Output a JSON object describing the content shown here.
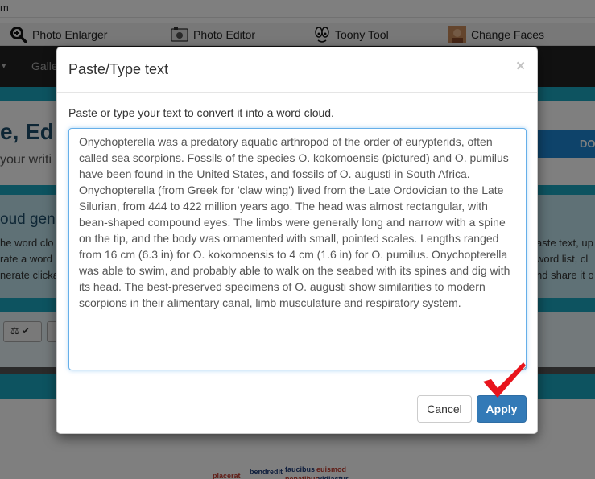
{
  "browser": {
    "url_fragment": "m"
  },
  "toolbar": {
    "items": [
      {
        "label": "Photo Enlarger",
        "icon": "magnifier-icon"
      },
      {
        "label": "Photo Editor",
        "icon": "photo-editor-icon"
      },
      {
        "label": "Toony Tool",
        "icon": "toony-face-icon"
      },
      {
        "label": "Change Faces",
        "icon": "face-avatar-icon"
      }
    ]
  },
  "navbar": {
    "gallery_label": "Galle"
  },
  "hero": {
    "title": "e, Ed",
    "subtitle": "your writi",
    "do_button": "DO"
  },
  "info": {
    "heading": "oud gen",
    "lines_left": [
      "he word clo",
      "rate a word",
      "nerate clicka"
    ],
    "lines_right": [
      "aste text, up",
      "word list, cl",
      "nd share it o"
    ]
  },
  "cloud_words": [
    {
      "text": "placerat",
      "color": "#c0392b"
    },
    {
      "text": "bendredit",
      "color": "#1f3d7a"
    },
    {
      "text": "faucibus",
      "color": "#1f3d7a"
    },
    {
      "text": "euismod",
      "color": "#c0392b"
    },
    {
      "text": "penatibus",
      "color": "#c0392b"
    },
    {
      "text": "vidiastur",
      "color": "#1f3d7a"
    }
  ],
  "modal": {
    "title": "Paste/Type text",
    "close": "×",
    "description": "Paste or type your text to convert it into a word cloud.",
    "text_value": "Onychopterella was a predatory aquatic arthropod of the order of eurypterids, often called sea scorpions. Fossils of the species O. kokomoensis (pictured) and O. pumilus have been found in the United States, and fossils of O. augusti in South Africa. Onychopterella (from Greek for 'claw wing') lived from the Late Ordovician to the Late Silurian, from 444 to 422 million years ago. The head was almost rectangular, with bean-shaped compound eyes. The limbs were generally long and narrow with a spine on the tip, and the body was ornamented with small, pointed scales. Lengths ranged from 16 cm (6.3 in) for O. kokomoensis to 4 cm (1.6 in) for O. pumilus. Onychopterella was able to swim, and probably able to walk on the seabed with its spines and dig with its head. The best-preserved specimens of O. augusti show similarities to modern scorpions in their alimentary canal, limb musculature and respiratory system.",
    "cancel_label": "Cancel",
    "apply_label": "Apply"
  },
  "colors": {
    "accent": "#337ab7",
    "teal": "#1ba6c0",
    "check": "#e8141c"
  }
}
